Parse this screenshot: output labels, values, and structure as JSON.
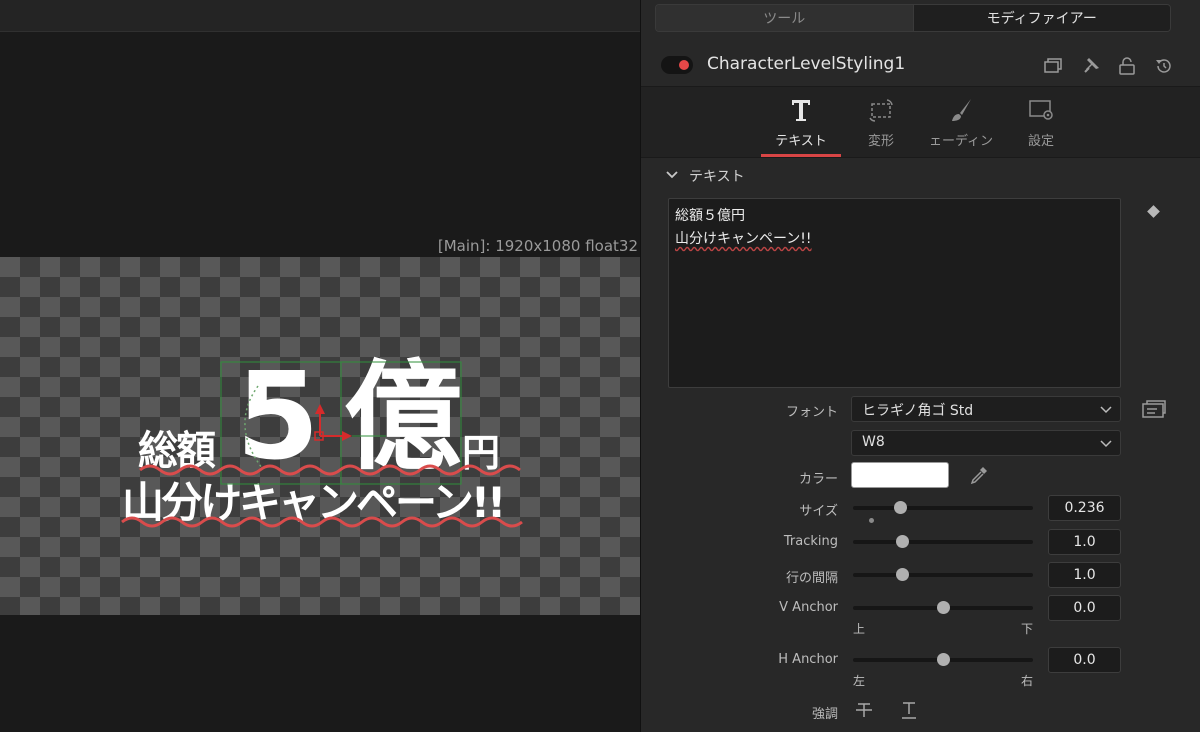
{
  "viewer": {
    "resolution_label": "[Main]: 1920x1080 float32",
    "canvas_text": {
      "line1_prefix": "総額",
      "line1_number": "5",
      "line1_unit": "億",
      "line1_suffix": "円",
      "line2": "山分けキャンペーン!!"
    }
  },
  "inspector": {
    "segment": {
      "tools": "ツール",
      "modifier": "モディファイアー"
    },
    "node": {
      "name": "CharacterLevelStyling1",
      "enabled": true,
      "toggle_color": "#e64848"
    },
    "header_icons": [
      "window-icon",
      "pin-icon",
      "lock-icon",
      "reset-icon"
    ],
    "tabs": [
      {
        "label": "テキスト",
        "icon": "text-T-icon",
        "active": true
      },
      {
        "label": "変形",
        "icon": "transform-icon",
        "active": false
      },
      {
        "label": "ェーディン",
        "icon": "brush-icon",
        "active": false
      },
      {
        "label": "設定",
        "icon": "settings-icon",
        "active": false
      }
    ],
    "accent_color": "#d84545",
    "section": {
      "title": "テキスト"
    },
    "styled_text": {
      "line1": "総額５億円",
      "line2": "山分けキャンペーン!!"
    },
    "font": {
      "label": "フォント",
      "family": "ヒラギノ角ゴ Std",
      "style": "W8"
    },
    "color": {
      "label": "カラー",
      "value": "#ffffff"
    },
    "params": {
      "size": {
        "label": "サイズ",
        "value": "0.236",
        "position": 0.26
      },
      "tracking": {
        "label": "Tracking",
        "value": "1.0",
        "position": 0.27
      },
      "line_spacing": {
        "label": "行の間隔",
        "value": "1.0",
        "position": 0.27
      },
      "v_anchor": {
        "label": "V Anchor",
        "value": "0.0",
        "position": 0.5,
        "min_label": "上",
        "max_label": "下"
      },
      "h_anchor": {
        "label": "H Anchor",
        "value": "0.0",
        "position": 0.5,
        "min_label": "左",
        "max_label": "右"
      }
    },
    "emphasis": {
      "label": "強調"
    }
  }
}
